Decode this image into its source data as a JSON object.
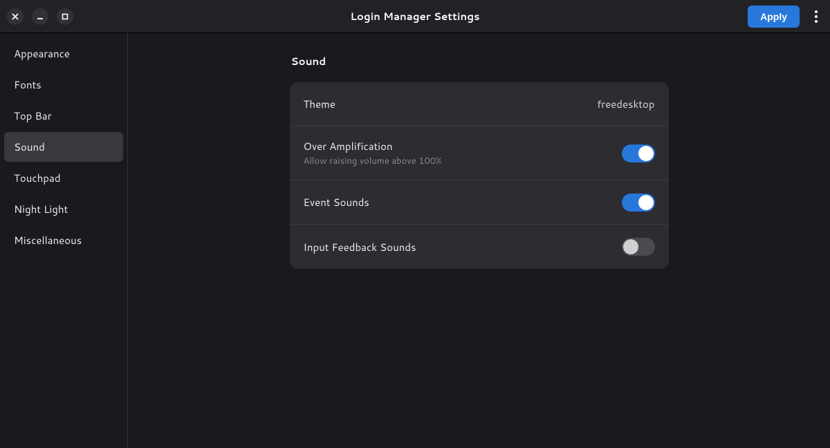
{
  "header": {
    "title": "Login Manager Settings",
    "apply_label": "Apply"
  },
  "sidebar": {
    "items": [
      {
        "label": "Appearance",
        "active": false
      },
      {
        "label": "Fonts",
        "active": false
      },
      {
        "label": "Top Bar",
        "active": false
      },
      {
        "label": "Sound",
        "active": true
      },
      {
        "label": "Touchpad",
        "active": false
      },
      {
        "label": "Night Light",
        "active": false
      },
      {
        "label": "Miscellaneous",
        "active": false
      }
    ]
  },
  "main": {
    "section_title": "Sound",
    "rows": {
      "theme": {
        "label": "Theme",
        "value": "freedesktop"
      },
      "over_amp": {
        "label": "Over Amplification",
        "sub": "Allow raising volume above 100%",
        "on": true
      },
      "event_sounds": {
        "label": "Event Sounds",
        "on": true
      },
      "input_feedback": {
        "label": "Input Feedback Sounds",
        "on": false
      }
    }
  }
}
